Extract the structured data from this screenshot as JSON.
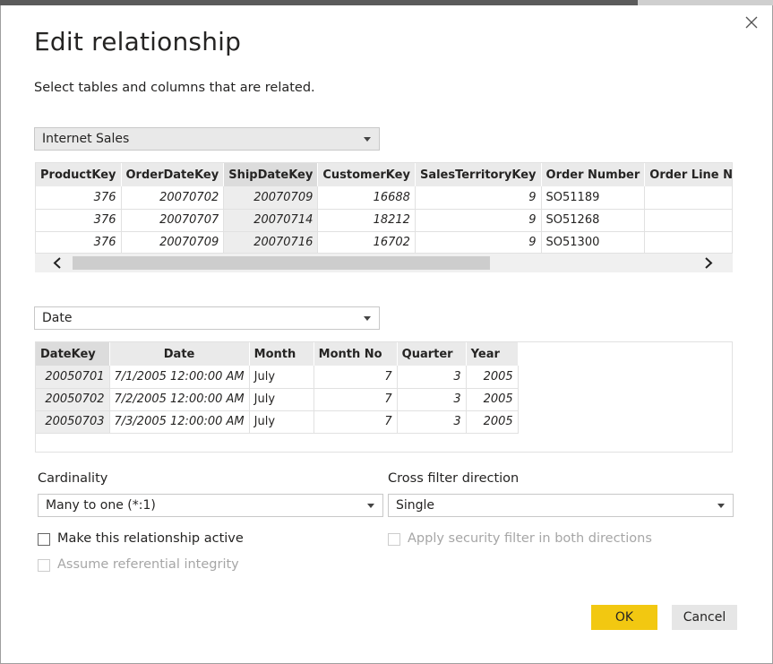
{
  "dialog": {
    "title": "Edit relationship",
    "subtitle": "Select tables and columns that are related."
  },
  "table1": {
    "selector_value": "Internet Sales",
    "columns": [
      "ProductKey",
      "OrderDateKey",
      "ShipDateKey",
      "CustomerKey",
      "SalesTerritoryKey",
      "Order Number",
      "Order Line Nu"
    ],
    "rows": [
      [
        "376",
        "20070702",
        "20070709",
        "16688",
        "9",
        "SO51189",
        ""
      ],
      [
        "376",
        "20070707",
        "20070714",
        "18212",
        "9",
        "SO51268",
        ""
      ],
      [
        "376",
        "20070709",
        "20070716",
        "16702",
        "9",
        "SO51300",
        ""
      ]
    ]
  },
  "table2": {
    "selector_value": "Date",
    "columns": [
      "DateKey",
      "Date",
      "Month",
      "Month No",
      "Quarter",
      "Year"
    ],
    "rows": [
      [
        "20050701",
        "7/1/2005 12:00:00 AM",
        "July",
        "7",
        "3",
        "2005"
      ],
      [
        "20050702",
        "7/2/2005 12:00:00 AM",
        "July",
        "7",
        "3",
        "2005"
      ],
      [
        "20050703",
        "7/3/2005 12:00:00 AM",
        "July",
        "7",
        "3",
        "2005"
      ]
    ]
  },
  "cardinality": {
    "label": "Cardinality",
    "value": "Many to one (*:1)"
  },
  "cross_filter": {
    "label": "Cross filter direction",
    "value": "Single"
  },
  "options": {
    "make_active": "Make this relationship active",
    "referential_integrity": "Assume referential integrity",
    "security_filter": "Apply security filter in both directions"
  },
  "buttons": {
    "ok": "OK",
    "cancel": "Cancel"
  },
  "colors": {
    "ok_button": "#f2c811",
    "selected_column": "#ededed"
  }
}
